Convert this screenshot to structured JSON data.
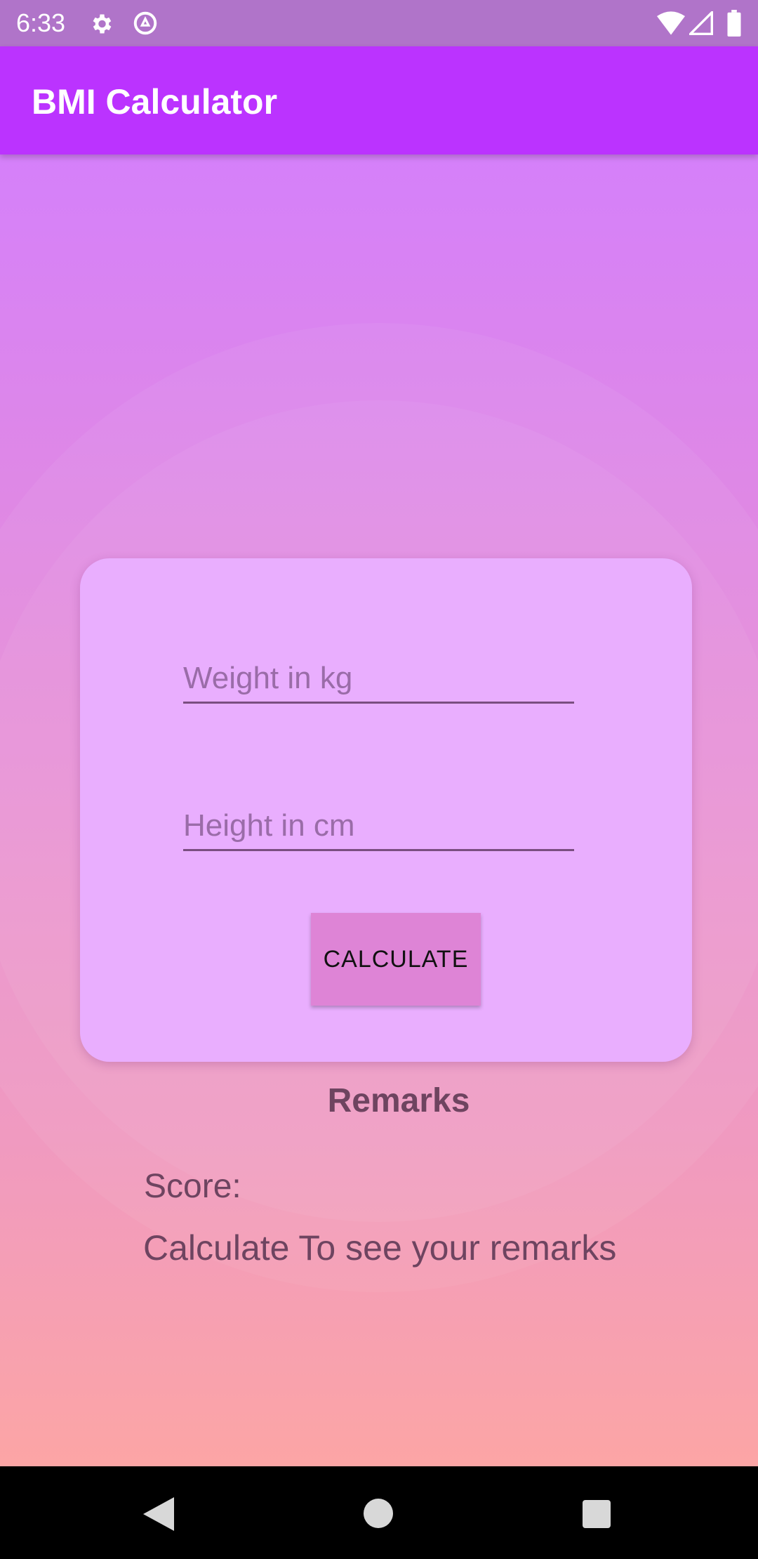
{
  "status_bar": {
    "time": "6:33",
    "icons": [
      "settings-icon",
      "data-saver-icon",
      "wifi-icon",
      "signal-icon",
      "battery-icon"
    ]
  },
  "app_bar": {
    "title": "BMI Calculator"
  },
  "form": {
    "weight": {
      "value": "",
      "placeholder": "Weight in kg"
    },
    "height": {
      "value": "",
      "placeholder": "Height in cm"
    },
    "calculate_label": "CALCULATE"
  },
  "results": {
    "heading": "Remarks",
    "score_label": "Score:",
    "message": "Calculate To see your remarks"
  },
  "nav_bar": {
    "icons": [
      "back-icon",
      "home-icon",
      "recents-icon"
    ]
  },
  "colors": {
    "app_bar": "#bb33ff",
    "card": "#e9aefe",
    "button": "#de84d6"
  }
}
